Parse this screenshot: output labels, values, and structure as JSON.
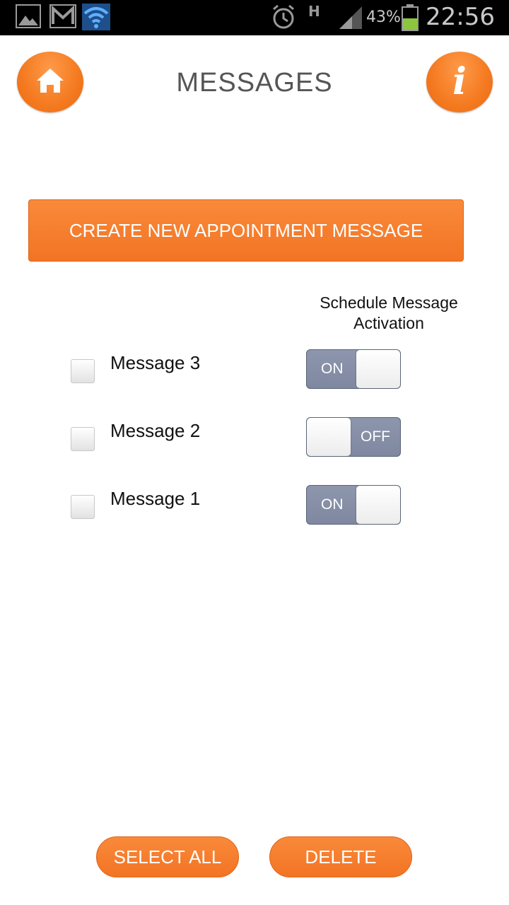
{
  "status_bar": {
    "battery_percent": "43%",
    "time": "22:56",
    "network_type": "H"
  },
  "header": {
    "title": "MESSAGES",
    "home_icon": "home-icon",
    "info_icon": "info-icon",
    "info_glyph": "i"
  },
  "create_button": {
    "label": "CREATE NEW APPOINTMENT MESSAGE"
  },
  "column_header": {
    "line1": "Schedule Message",
    "line2": "Activation"
  },
  "messages": [
    {
      "label": "Message 3",
      "checked": false,
      "toggle": "ON"
    },
    {
      "label": "Message 2",
      "checked": false,
      "toggle": "OFF"
    },
    {
      "label": "Message 1",
      "checked": false,
      "toggle": "ON"
    }
  ],
  "footer": {
    "select_all_label": "SELECT ALL",
    "delete_label": "DELETE"
  },
  "colors": {
    "accent_orange": "#f47a20",
    "toggle_track": "#8891a8"
  }
}
